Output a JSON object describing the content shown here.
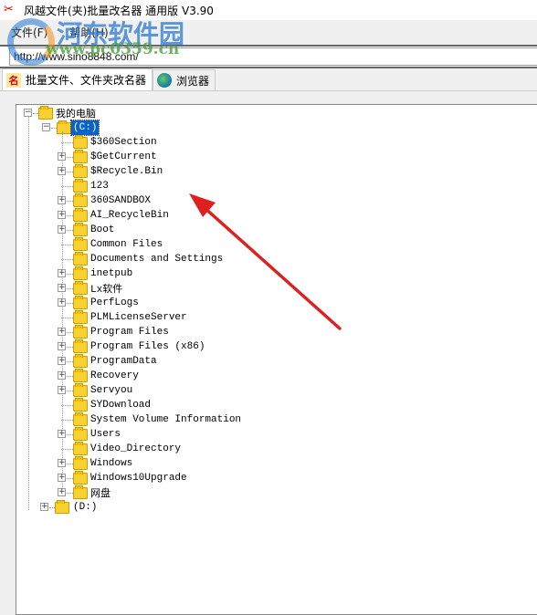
{
  "window": {
    "title": "风越文件(夹)批量改名器 通用版 V3.90",
    "icon": "app-logo-icon"
  },
  "menu": [
    {
      "label": "文件(F)"
    },
    {
      "label": "帮助(H)"
    }
  ],
  "address": {
    "value": "http://www.sino8848.com/"
  },
  "tabs": [
    {
      "label": "批量文件、文件夹改名器",
      "icon": "rename-icon",
      "active": true
    },
    {
      "label": "浏览器",
      "icon": "globe-icon",
      "active": false
    }
  ],
  "tree": {
    "root": {
      "label": "我的电脑",
      "expanded": true
    },
    "drive_c": {
      "label": "(C:)",
      "expanded": true,
      "selected": true
    },
    "children": [
      {
        "label": "$360Section",
        "expandable": false
      },
      {
        "label": "$GetCurrent",
        "expandable": true
      },
      {
        "label": "$Recycle.Bin",
        "expandable": true
      },
      {
        "label": "123",
        "expandable": false
      },
      {
        "label": "360SANDBOX",
        "expandable": true
      },
      {
        "label": "AI_RecycleBin",
        "expandable": true
      },
      {
        "label": "Boot",
        "expandable": true
      },
      {
        "label": "Common Files",
        "expandable": false
      },
      {
        "label": "Documents and Settings",
        "expandable": false
      },
      {
        "label": "inetpub",
        "expandable": true
      },
      {
        "label": "Lx软件",
        "expandable": true
      },
      {
        "label": "PerfLogs",
        "expandable": true
      },
      {
        "label": "PLMLicenseServer",
        "expandable": false
      },
      {
        "label": "Program Files",
        "expandable": true
      },
      {
        "label": "Program Files (x86)",
        "expandable": true
      },
      {
        "label": "ProgramData",
        "expandable": true
      },
      {
        "label": "Recovery",
        "expandable": true
      },
      {
        "label": "Servyou",
        "expandable": true
      },
      {
        "label": "SYDownload",
        "expandable": false
      },
      {
        "label": "System Volume Information",
        "expandable": false
      },
      {
        "label": "Users",
        "expandable": true
      },
      {
        "label": "Video_Directory",
        "expandable": false
      },
      {
        "label": "Windows",
        "expandable": true
      },
      {
        "label": "Windows10Upgrade",
        "expandable": true
      },
      {
        "label": "网盘",
        "expandable": true
      }
    ],
    "drive_d": {
      "label": "(D:)",
      "expanded": false
    }
  },
  "watermark": {
    "name": "河东软件园",
    "url": "www.pc0359.cn"
  },
  "annotation": {
    "type": "arrow",
    "color": "#e02020"
  }
}
